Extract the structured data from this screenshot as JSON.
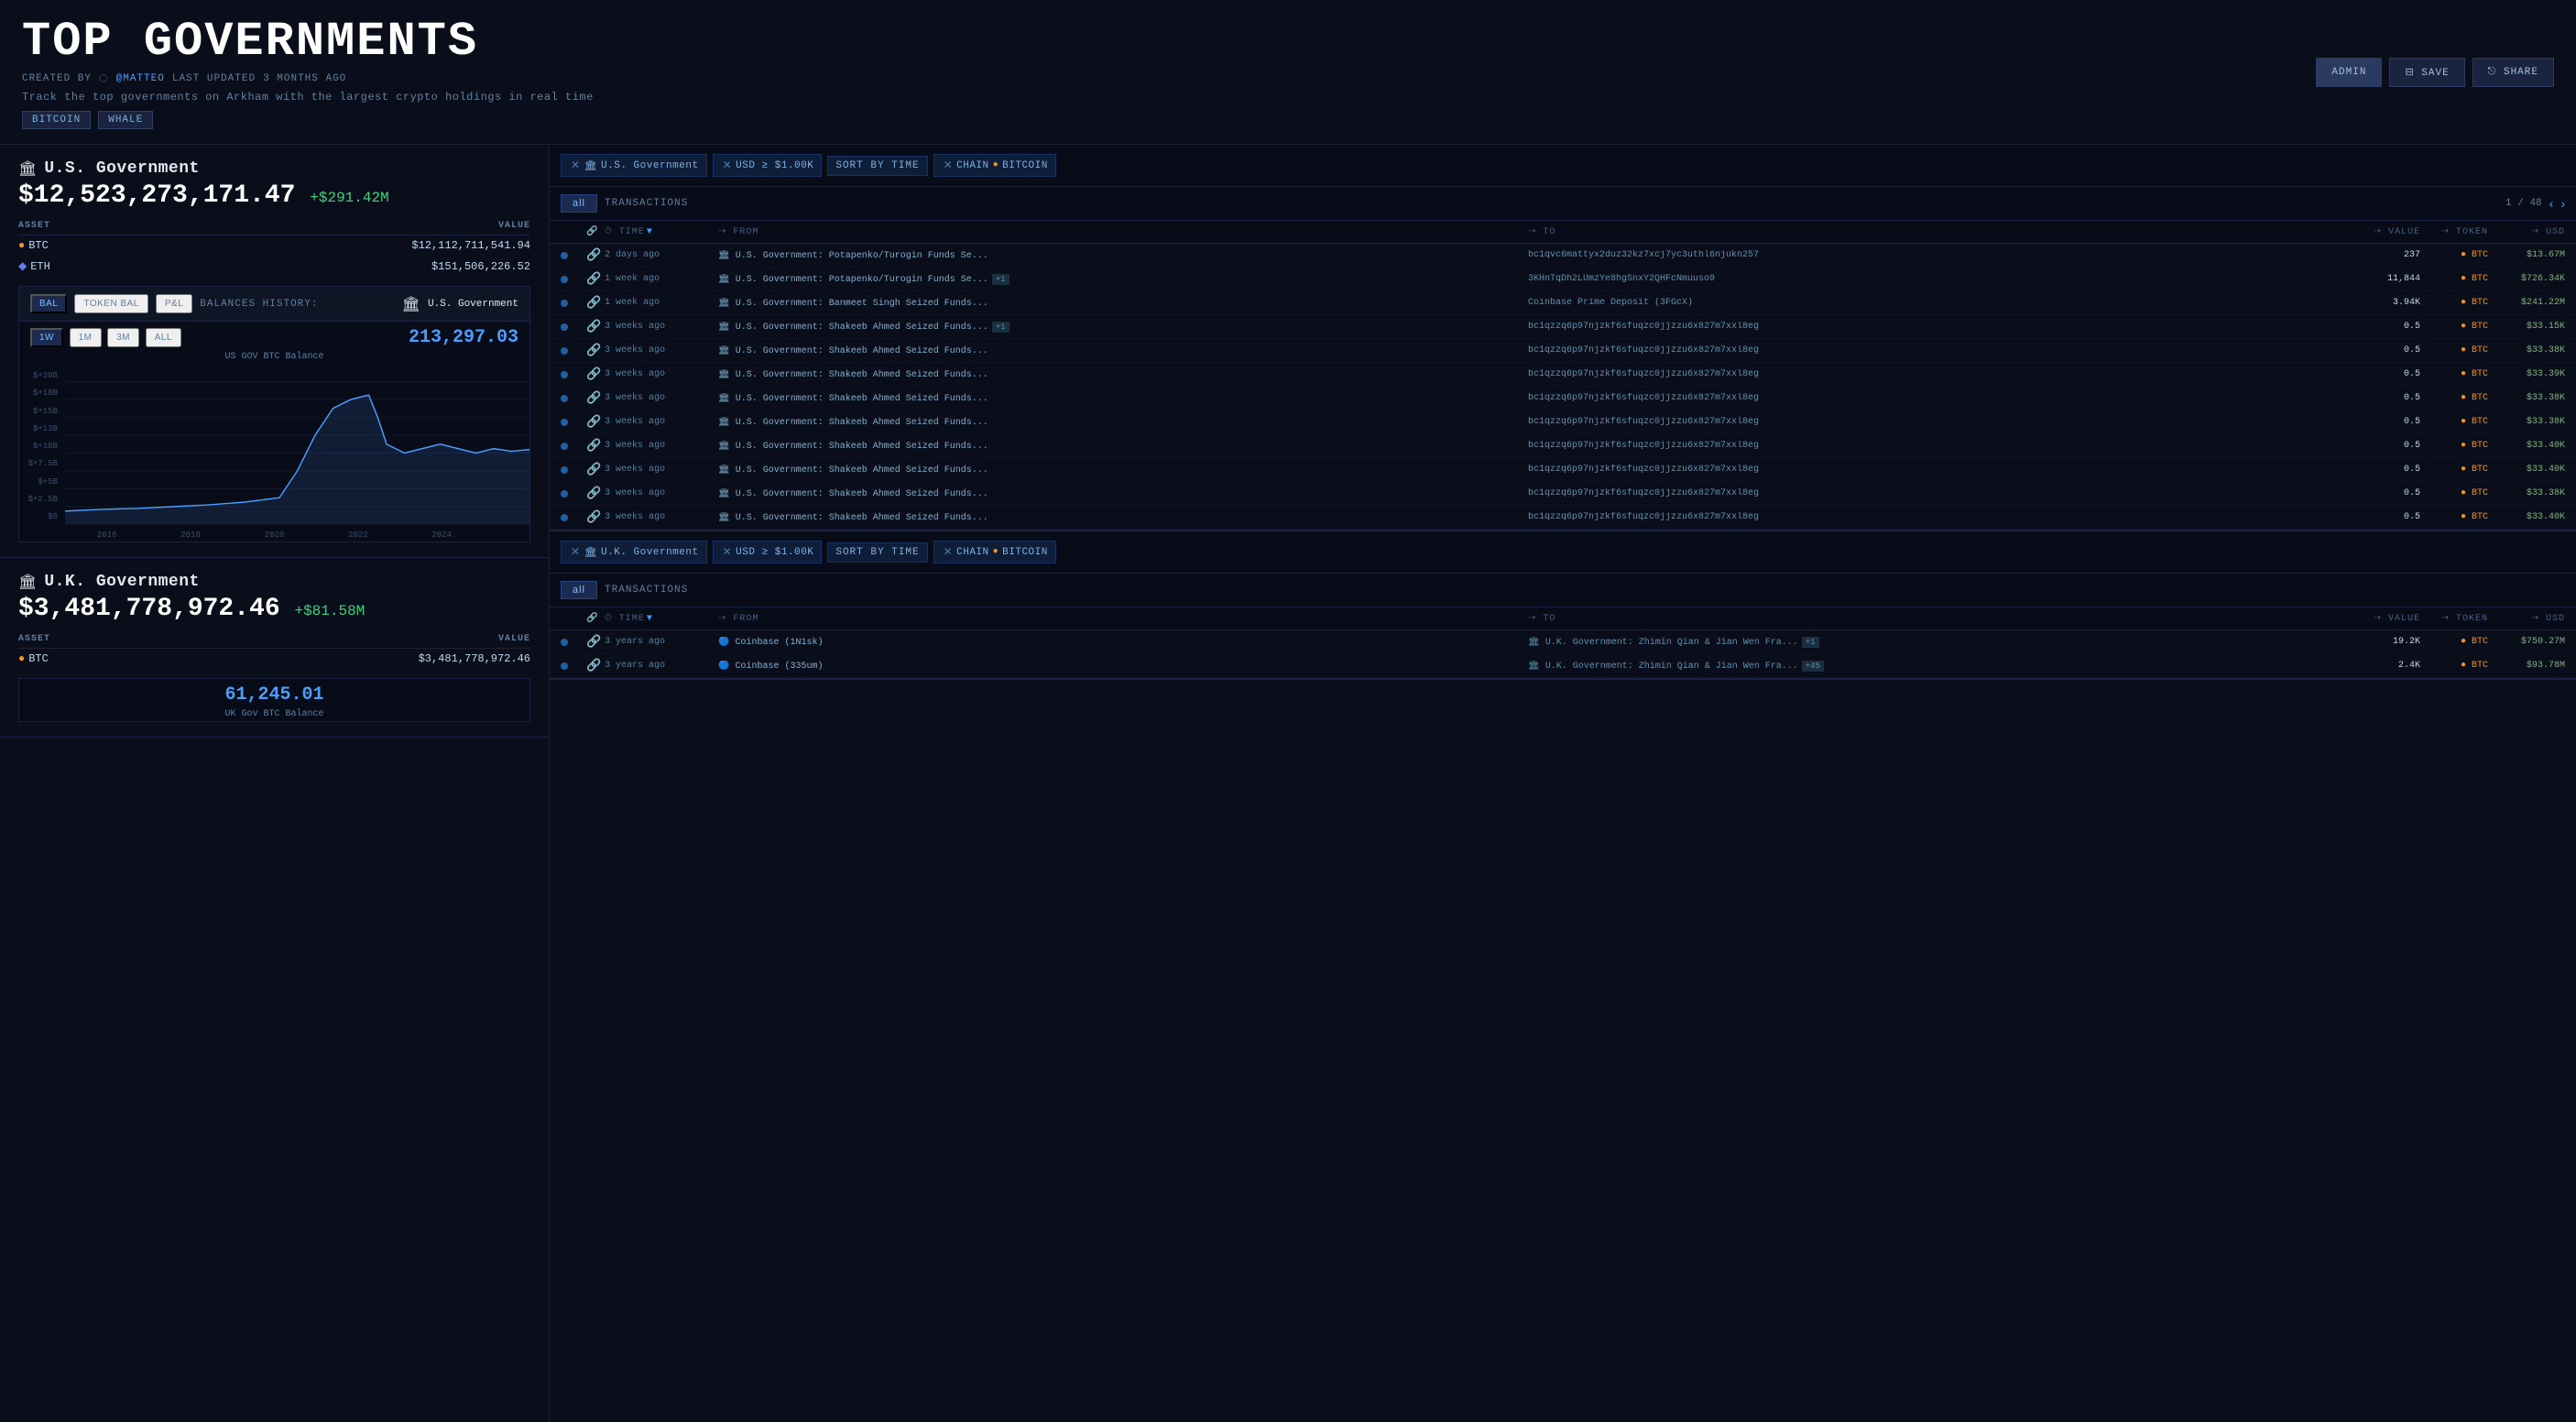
{
  "header": {
    "title": "TOP GOVERNMENTS",
    "subtitle": "Track the top governments on Arkham with the largest crypto holdings in real time",
    "meta": {
      "created_by": "CREATED BY",
      "username": "@MATTEO",
      "last_updated": "LAST UPDATED",
      "time_ago": "3 MONTHS AGO"
    },
    "tags": [
      "BITCOIN",
      "WHALE"
    ],
    "buttons": {
      "admin": "ADMIN",
      "save": "SAVE",
      "share": "SHARE"
    }
  },
  "govs": [
    {
      "icon": "🏛",
      "name": "U.S. Government",
      "balance": "$12,523,273,171.47",
      "change": "+$291.42M",
      "chart_title": "US GOV BTC Balance",
      "chart_value": "213,297.03",
      "assets": [
        {
          "symbol": "BTC",
          "type": "btc",
          "value": "$12,112,711,541.94"
        },
        {
          "symbol": "ETH",
          "type": "eth",
          "value": "$151,506,226.52"
        }
      ],
      "chart_y_labels": [
        "$+20B",
        "$+18B",
        "$+15B",
        "$+13B",
        "$+10B",
        "$+7.5B",
        "$+5B",
        "$+2.5B",
        "$0"
      ],
      "chart_x_labels": [
        "2016",
        "2018",
        "2020",
        "2022",
        "2024"
      ]
    },
    {
      "icon": "🏛",
      "name": "U.K. Government",
      "balance": "$3,481,778,972.46",
      "change": "+$81.58M",
      "chart_title": "UK Gov BTC Balance",
      "chart_value": "61,245.01",
      "assets": [
        {
          "symbol": "BTC",
          "type": "btc",
          "value": "$3,481,778,972.46"
        }
      ]
    }
  ],
  "tx_panel_1": {
    "filters": [
      {
        "icon": "🏛",
        "label": "U.S. Government",
        "removable": true
      },
      {
        "label": "USD ≥ $1.00K",
        "removable": true
      },
      {
        "label": "SORT BY TIME",
        "removable": false,
        "is_sort": true
      },
      {
        "label": "CHAIN",
        "chain_icon": true,
        "chain_label": "BITCOIN",
        "removable": true
      }
    ],
    "tab_all": "all",
    "nav": {
      "label": "TRANSACTIONS",
      "page_current": 1,
      "page_total": 48
    },
    "col_headers": [
      "",
      "",
      "TIME",
      "FROM",
      "TO",
      "VALUE",
      "TOKEN",
      "USD"
    ],
    "rows": [
      {
        "time": "2 days ago",
        "from": "🏛 U.S. Government: Potapenko/Turogin Funds Se...",
        "to": "bc1qvc6mattyx2duz32kz7xcj7yc3uthl6njukn257",
        "value": "237",
        "token": "BTC",
        "usd": "$13.67M",
        "badge": null
      },
      {
        "time": "1 week ago",
        "from": "🏛 U.S. Government: Potapenko/Turogin Funds Se...",
        "to": "3KHnTqDh2LUmzYe8hgSnxY2QHFcNmuuso9",
        "value": "11,844",
        "token": "BTC",
        "usd": "$726.34K",
        "badge": "+1"
      },
      {
        "time": "1 week ago",
        "from": "🏛 U.S. Government: Banmeet Singh Seized Funds...",
        "to": "Coinbase Prime Deposit (3FGcX)",
        "value": "3.94K",
        "token": "BTC",
        "usd": "$241.22M",
        "badge": null
      },
      {
        "time": "3 weeks ago",
        "from": "🏛 U.S. Government: Shakeeb Ahmed Seized Funds...",
        "to": "bc1qzzq6p97njzkf6sfuqzc0jjzzu6x827m7xxl8eg",
        "value": "0.5",
        "token": "BTC",
        "usd": "$33.15K",
        "badge": "+1"
      },
      {
        "time": "3 weeks ago",
        "from": "🏛 U.S. Government: Shakeeb Ahmed Seized Funds...",
        "to": "bc1qzzq6p97njzkf6sfuqzc0jjzzu6x827m7xxl8eg",
        "value": "0.5",
        "token": "BTC",
        "usd": "$33.38K",
        "badge": null
      },
      {
        "time": "3 weeks ago",
        "from": "🏛 U.S. Government: Shakeeb Ahmed Seized Funds...",
        "to": "bc1qzzq6p97njzkf6sfuqzc0jjzzu6x827m7xxl8eg",
        "value": "0.5",
        "token": "BTC",
        "usd": "$33.39K",
        "badge": null
      },
      {
        "time": "3 weeks ago",
        "from": "🏛 U.S. Government: Shakeeb Ahmed Seized Funds...",
        "to": "bc1qzzq6p97njzkf6sfuqzc0jjzzu6x827m7xxl8eg",
        "value": "0.5",
        "token": "BTC",
        "usd": "$33.38K",
        "badge": null
      },
      {
        "time": "3 weeks ago",
        "from": "🏛 U.S. Government: Shakeeb Ahmed Seized Funds...",
        "to": "bc1qzzq6p97njzkf6sfuqzc0jjzzu6x827m7xxl8eg",
        "value": "0.5",
        "token": "BTC",
        "usd": "$33.38K",
        "badge": null
      },
      {
        "time": "3 weeks ago",
        "from": "🏛 U.S. Government: Shakeeb Ahmed Seized Funds...",
        "to": "bc1qzzq6p97njzkf6sfuqzc0jjzzu6x827m7xxl8eg",
        "value": "0.5",
        "token": "BTC",
        "usd": "$33.40K",
        "badge": null
      },
      {
        "time": "3 weeks ago",
        "from": "🏛 U.S. Government: Shakeeb Ahmed Seized Funds...",
        "to": "bc1qzzq6p97njzkf6sfuqzc0jjzzu6x827m7xxl8eg",
        "value": "0.5",
        "token": "BTC",
        "usd": "$33.40K",
        "badge": null
      },
      {
        "time": "3 weeks ago",
        "from": "🏛 U.S. Government: Shakeeb Ahmed Seized Funds...",
        "to": "bc1qzzq6p97njzkf6sfuqzc0jjzzu6x827m7xxl8eg",
        "value": "0.5",
        "token": "BTC",
        "usd": "$33.38K",
        "badge": null
      },
      {
        "time": "3 weeks ago",
        "from": "🏛 U.S. Government: Shakeeb Ahmed Seized Funds...",
        "to": "bc1qzzq6p97njzkf6sfuqzc0jjzzu6x827m7xxl8eg",
        "value": "0.5",
        "token": "BTC",
        "usd": "$33.40K",
        "badge": null
      }
    ]
  },
  "tx_panel_2": {
    "filters": [
      {
        "icon": "🏛",
        "label": "U.K. Government",
        "removable": true
      },
      {
        "label": "USD ≥ $1.00K",
        "removable": true
      },
      {
        "label": "SORT BY TIME",
        "removable": false,
        "is_sort": true
      },
      {
        "label": "CHAIN",
        "chain_icon": true,
        "chain_label": "BITCOIN",
        "removable": true
      }
    ],
    "tab_all": "all",
    "nav": {
      "label": "TRANSACTIONS"
    },
    "col_headers": [
      "",
      "",
      "TIME",
      "FROM",
      "TO",
      "VALUE",
      "TOKEN",
      "USD"
    ],
    "rows": [
      {
        "time": "3 years ago",
        "from": "🔵 Coinbase (1N1sk)",
        "badge": "+1",
        "to": "🏛 U.K. Government: Zhimin Qian & Jian Wen Fra...",
        "value": "19.2K",
        "token": "BTC",
        "usd": "$750.27M"
      },
      {
        "time": "3 years ago",
        "from": "🔵 Coinbase (335um)",
        "badge": "+45",
        "to": "🏛 U.K. Government: Zhimin Qian & Jian Wen Fra...",
        "value": "2.4K",
        "token": "BTC",
        "usd": "$93.78M"
      }
    ]
  }
}
